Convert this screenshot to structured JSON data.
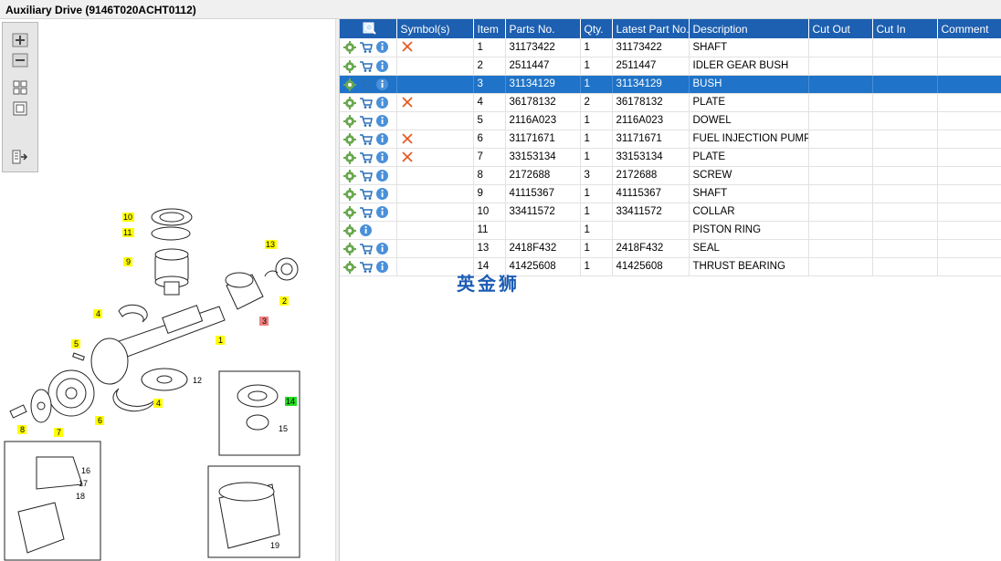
{
  "window": {
    "title": "Auxiliary Drive (9146T020ACHT0112)"
  },
  "toolbar": {
    "buttons": [
      "zoom-in",
      "zoom-out",
      "fit-page",
      "actual-size",
      "export"
    ]
  },
  "diagram": {
    "callouts": [
      "10",
      "11",
      "9",
      "13",
      "2",
      "3",
      "4",
      "1",
      "5",
      "12",
      "14",
      "15",
      "4",
      "8",
      "7",
      "6",
      "16",
      "17",
      "18",
      "19"
    ]
  },
  "table": {
    "headers": [
      "",
      "Symbol(s)",
      "Item",
      "Parts No.",
      "Qty.",
      "Latest Part No.",
      "Description",
      "Cut Out",
      "Cut In",
      "Comment"
    ],
    "rows": [
      {
        "item": "1",
        "parts_no": "31173422",
        "qty": "1",
        "latest": "31173422",
        "desc": "SHAFT",
        "symbol": "x",
        "cart": true,
        "selected": false
      },
      {
        "item": "2",
        "parts_no": "2511447",
        "qty": "1",
        "latest": "2511447",
        "desc": "IDLER GEAR BUSH",
        "symbol": "",
        "cart": true,
        "selected": false
      },
      {
        "item": "3",
        "parts_no": "31134129",
        "qty": "1",
        "latest": "31134129",
        "desc": "BUSH",
        "symbol": "",
        "cart": true,
        "selected": true
      },
      {
        "item": "4",
        "parts_no": "36178132",
        "qty": "2",
        "latest": "36178132",
        "desc": "PLATE",
        "symbol": "x",
        "cart": true,
        "selected": false
      },
      {
        "item": "5",
        "parts_no": "2116A023",
        "qty": "1",
        "latest": "2116A023",
        "desc": "DOWEL",
        "symbol": "",
        "cart": true,
        "selected": false
      },
      {
        "item": "6",
        "parts_no": "31171671",
        "qty": "1",
        "latest": "31171671",
        "desc": "FUEL INJECTION PUMP G",
        "symbol": "x",
        "cart": true,
        "selected": false
      },
      {
        "item": "7",
        "parts_no": "33153134",
        "qty": "1",
        "latest": "33153134",
        "desc": "PLATE",
        "symbol": "x",
        "cart": true,
        "selected": false
      },
      {
        "item": "8",
        "parts_no": "2172688",
        "qty": "3",
        "latest": "2172688",
        "desc": "SCREW",
        "symbol": "",
        "cart": true,
        "selected": false
      },
      {
        "item": "9",
        "parts_no": "41115367",
        "qty": "1",
        "latest": "41115367",
        "desc": "SHAFT",
        "symbol": "",
        "cart": true,
        "selected": false
      },
      {
        "item": "10",
        "parts_no": "33411572",
        "qty": "1",
        "latest": "33411572",
        "desc": "COLLAR",
        "symbol": "",
        "cart": true,
        "selected": false
      },
      {
        "item": "11",
        "parts_no": "",
        "qty": "1",
        "latest": "",
        "desc": "PISTON RING",
        "symbol": "",
        "cart": false,
        "selected": false
      },
      {
        "item": "13",
        "parts_no": "2418F432",
        "qty": "1",
        "latest": "2418F432",
        "desc": "SEAL",
        "symbol": "",
        "cart": true,
        "selected": false
      },
      {
        "item": "14",
        "parts_no": "41425608",
        "qty": "1",
        "latest": "41425608",
        "desc": "THRUST BEARING",
        "symbol": "",
        "cart": true,
        "selected": false
      }
    ]
  },
  "watermark": "英金狮",
  "colors": {
    "header_bg": "#1d5fb0",
    "selected_bg": "#1f73c8",
    "symbol_x": "#e8541c",
    "callout_yellow": "#ffff00",
    "callout_red": "#f08080",
    "callout_green": "#22dd22"
  }
}
